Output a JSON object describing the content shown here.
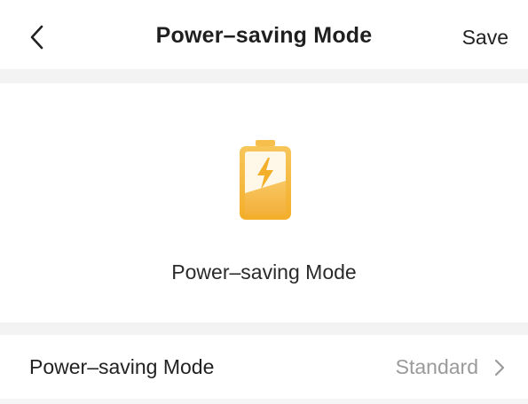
{
  "header": {
    "back_icon": "chevron-left-icon",
    "title": "Power–saving Mode",
    "save_label": "Save"
  },
  "hero": {
    "icon": "battery-charging-icon",
    "icon_color": "#F5B93A",
    "label": "Power–saving Mode"
  },
  "setting": {
    "label": "Power–saving Mode",
    "value": "Standard",
    "chevron_icon": "chevron-right-icon"
  },
  "colors": {
    "background": "#F6F6F6",
    "card": "#FFFFFF",
    "primary_text": "#222222",
    "secondary_text": "#9A9A9A",
    "accent": "#F5B93A"
  }
}
